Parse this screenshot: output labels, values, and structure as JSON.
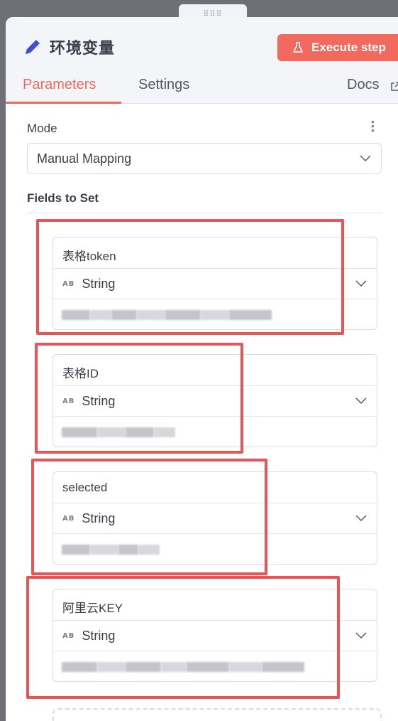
{
  "header": {
    "title": "环境变量",
    "execute_label": "Execute step",
    "drag_handle": "⠿⠿⠿"
  },
  "tabs": [
    {
      "label": "Parameters",
      "active": true
    },
    {
      "label": "Settings",
      "active": false
    },
    {
      "label": "Docs",
      "active": false
    }
  ],
  "mode": {
    "label": "Mode",
    "value": "Manual Mapping"
  },
  "fields_label": "Fields to Set",
  "fields": [
    {
      "name": "表格token",
      "type": "String",
      "type_icon": "AB"
    },
    {
      "name": "表格ID",
      "type": "String",
      "type_icon": "AB"
    },
    {
      "name": "selected",
      "type": "String",
      "type_icon": "AB"
    },
    {
      "name": "阿里云KEY",
      "type": "String",
      "type_icon": "AB"
    }
  ],
  "colors": {
    "accent": "#f2695d",
    "highlight": "#ec5454",
    "pencil": "#3d4ed8"
  }
}
